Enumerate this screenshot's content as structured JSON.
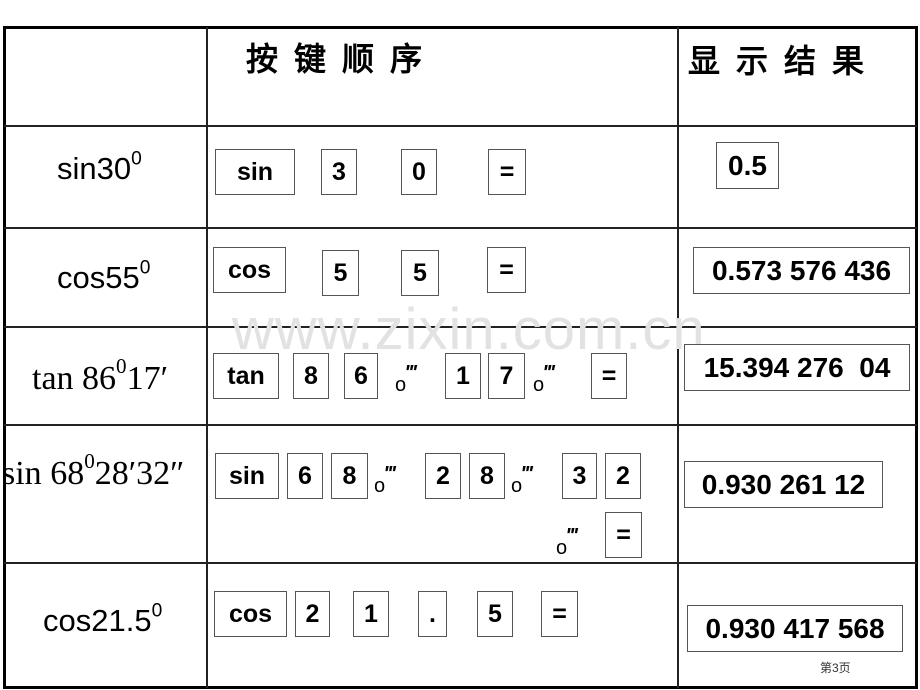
{
  "header": {
    "keys_title": "按键顺序",
    "result_title": "显示结果"
  },
  "rows": [
    {
      "expression": {
        "fn": "sin",
        "base": "30",
        "deg": "0",
        "rest": ""
      },
      "keys": [
        "sin",
        "3",
        "0",
        "="
      ],
      "result": "0.5"
    },
    {
      "expression": {
        "fn": "cos",
        "base": "55",
        "deg": "0",
        "rest": ""
      },
      "keys": [
        "cos",
        "5",
        "5",
        "="
      ],
      "result": "0.573 576 436"
    },
    {
      "expression": {
        "fn": "tan ",
        "base": "86",
        "deg": "0",
        "rest": "17′"
      },
      "keys": [
        "tan",
        "8",
        "6",
        "°′″",
        "1",
        "7",
        "°′″",
        "="
      ],
      "result": "15.394 276  04"
    },
    {
      "expression": {
        "fn": "sin ",
        "base": "68",
        "deg": "0",
        "rest": "28′32″"
      },
      "keys": [
        "sin",
        "6",
        "8",
        "°′″",
        "2",
        "8",
        "°′″",
        "3",
        "2",
        "°′″",
        "="
      ],
      "result": "0.930 261 12"
    },
    {
      "expression": {
        "fn": "cos",
        "base": "21.5",
        "deg": "0",
        "rest": ""
      },
      "keys": [
        "cos",
        "2",
        "1",
        ".",
        "5",
        "="
      ],
      "result": "0.930 417 568"
    }
  ],
  "dms_key": {
    "circle": "o",
    "marks": "‴"
  },
  "watermark": "www.zixin.com.cn",
  "page_number": "第3页"
}
